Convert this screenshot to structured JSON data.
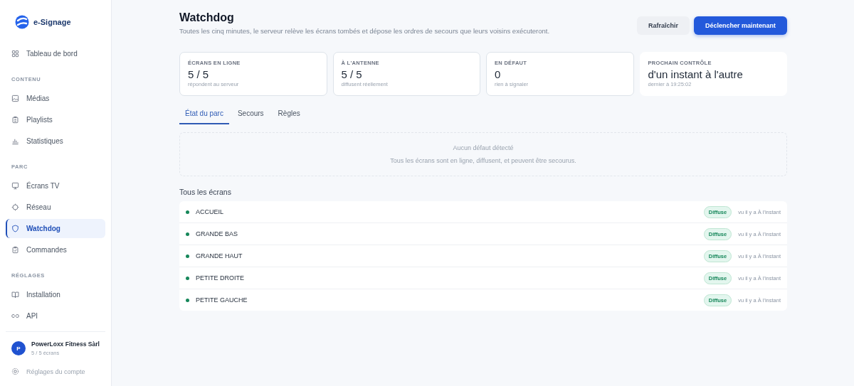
{
  "sidebar": {
    "brand": "e-Signage",
    "sections": [
      {
        "items": [
          {
            "label": "Tableau de bord",
            "selected": false
          }
        ]
      },
      {
        "title": "CONTENU",
        "items": [
          {
            "label": "Médias",
            "selected": false
          },
          {
            "label": "Playlists",
            "selected": false
          },
          {
            "label": "Statistiques",
            "selected": false
          }
        ]
      },
      {
        "title": "PARC",
        "items": [
          {
            "label": "Écrans TV",
            "selected": false
          },
          {
            "label": "Réseau",
            "selected": false
          },
          {
            "label": "Watchdog",
            "selected": true
          },
          {
            "label": "Commandes",
            "selected": false
          }
        ]
      },
      {
        "title": "RÉGLAGES",
        "items": [
          {
            "label": "Installation",
            "selected": false
          },
          {
            "label": "API",
            "selected": false
          }
        ]
      }
    ],
    "account": {
      "initial": "P",
      "name": "PowerLoxx Fitness Sàrl",
      "subtitle": "5 / 5 écrans"
    },
    "footer_link": "Réglages du compte"
  },
  "header": {
    "title": "Watchdog",
    "subtitle": "Toutes les cinq minutes, le serveur relève les écrans tombés et dépose les ordres de secours que leurs voisins exécuteront.",
    "buttons": [
      {
        "label": "Rafraîchir",
        "kind": "secondary"
      },
      {
        "label": "Déclencher maintenant",
        "kind": "primary"
      }
    ]
  },
  "stats": [
    {
      "label": "ÉCRANS EN LIGNE",
      "value": "5 / 5",
      "caption": "répondent au serveur"
    },
    {
      "label": "À L'ANTENNE",
      "value": "5 / 5",
      "caption": "diffusent réellement"
    },
    {
      "label": "EN DÉFAUT",
      "value": "0",
      "caption": "rien à signaler"
    },
    {
      "label": "PROCHAIN CONTRÔLE",
      "value": "d'un instant à l'autre",
      "caption": "dernier à 19:25:02"
    }
  ],
  "tabs": [
    {
      "label": "État du parc",
      "selected": true
    },
    {
      "label": "Secours",
      "selected": false
    },
    {
      "label": "Règles",
      "selected": false
    }
  ],
  "empty_state": {
    "title": "Aucun défaut détecté",
    "message": "Tous les écrans sont en ligne, diffusent, et peuvent être secourus."
  },
  "screens": {
    "title": "Tous les écrans",
    "rows": [
      {
        "name": "ACCUEIL",
        "color": "#16875a",
        "status": "Diffuse",
        "seen": "vu il y a À l'instant"
      },
      {
        "name": "GRANDE BAS",
        "color": "#16875a",
        "status": "Diffuse",
        "seen": "vu il y a À l'instant"
      },
      {
        "name": "GRANDE HAUT",
        "color": "#16875a",
        "status": "Diffuse",
        "seen": "vu il y a À l'instant"
      },
      {
        "name": "PETITE DROITE",
        "color": "#16875a",
        "status": "Diffuse",
        "seen": "vu il y a À l'instant"
      },
      {
        "name": "PETITE GAUCHE",
        "color": "#16875a",
        "status": "Diffuse",
        "seen": "vu il y a À l'instant"
      }
    ]
  }
}
